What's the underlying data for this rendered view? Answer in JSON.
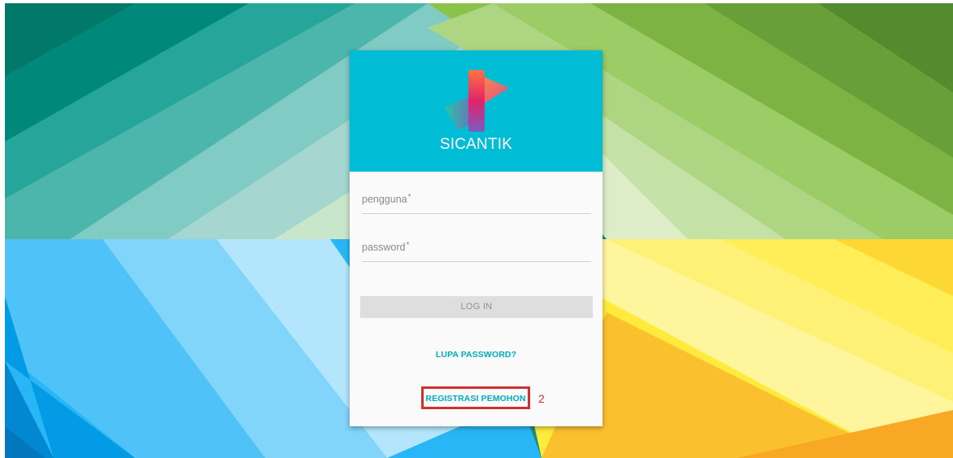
{
  "app": {
    "title": "SICANTIK"
  },
  "form": {
    "username": {
      "label": "pengguna",
      "required_mark": "*",
      "value": ""
    },
    "password": {
      "label": "password",
      "required_mark": "*",
      "value": ""
    },
    "login_label": "LOG IN",
    "forgot_label": "LUPA PASSWORD?",
    "register_label": "REGISTRASI PEMOHON"
  },
  "annotation": {
    "number": "2",
    "color": "#d32f2f"
  },
  "colors": {
    "header": "#00bcd4",
    "link": "#00acc1",
    "card": "#fafafa",
    "button": "#dedede"
  }
}
